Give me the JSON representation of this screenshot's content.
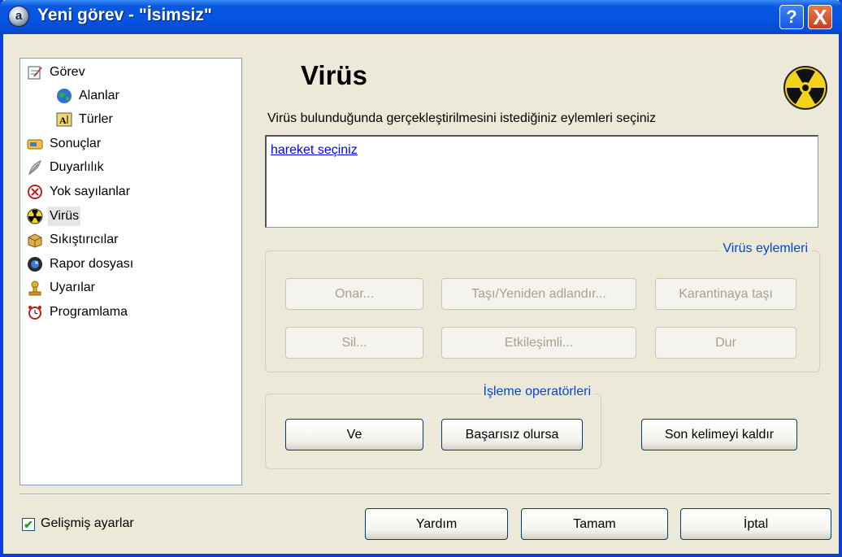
{
  "window": {
    "title": "Yeni görev - \"İsimsiz\"",
    "help_glyph": "?",
    "close_glyph": "X"
  },
  "tree": {
    "items": [
      {
        "label": "Görev",
        "icon": "task-icon"
      },
      {
        "label": "Alanlar",
        "icon": "globe-icon"
      },
      {
        "label": "Türler",
        "icon": "types-icon"
      },
      {
        "label": "Sonuçlar",
        "icon": "results-icon"
      },
      {
        "label": "Duyarlılık",
        "icon": "feather-icon"
      },
      {
        "label": "Yok sayılanlar",
        "icon": "excluded-icon"
      },
      {
        "label": "Virüs",
        "icon": "radiation-icon"
      },
      {
        "label": "Sıkıştırıcılar",
        "icon": "archive-icon"
      },
      {
        "label": "Rapor dosyası",
        "icon": "report-icon"
      },
      {
        "label": "Uyarılar",
        "icon": "alert-icon"
      },
      {
        "label": "Programlama",
        "icon": "alarm-clock-icon"
      }
    ]
  },
  "main": {
    "heading": "Virüs",
    "instruction": "Virüs bulunduğunda gerçekleştirilmesini istediğiniz eylemleri seçiniz",
    "actions_link": "hareket seçiniz",
    "virus_actions": {
      "legend": "Virüs eylemleri",
      "repair": "Onar...",
      "move_rename": "Taşı/Yeniden adlandır...",
      "quarantine": "Karantinaya taşı",
      "delete": "Sil...",
      "interactive": "Etkileşimli...",
      "stop": "Dur"
    },
    "operators": {
      "legend": "İşleme operatörleri",
      "and": "Ve",
      "if_fail": "Başarısız olursa",
      "remove_last": "Son kelimeyi kaldır"
    }
  },
  "footer": {
    "advanced_label": "Gelişmiş ayarlar",
    "advanced_checked": true,
    "check_glyph": "✔",
    "help": "Yardım",
    "ok": "Tamam",
    "cancel": "İptal"
  },
  "colors": {
    "title_bar": "#0454e3",
    "group_legend": "#0046d5",
    "link": "#0000ee"
  }
}
